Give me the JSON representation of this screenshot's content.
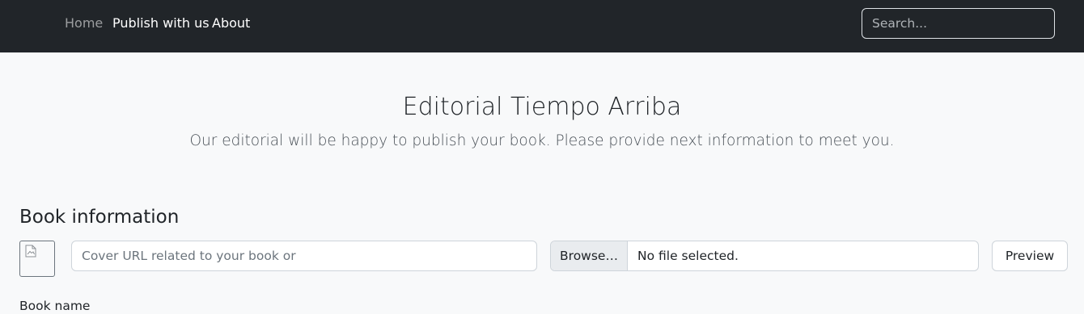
{
  "navbar": {
    "links": [
      {
        "label": "Home",
        "muted": true
      },
      {
        "label": "Publish with us",
        "muted": false
      },
      {
        "label": "About",
        "muted": false
      }
    ],
    "search_placeholder": "Search..."
  },
  "hero": {
    "title": "Editorial Tiempo Arriba",
    "subtitle": "Our editorial will be happy to publish your book. Please provide next information to meet you."
  },
  "book_section": {
    "title": "Book information",
    "cover_placeholder": "Cover URL related to your book or",
    "file_browse_label": "Browse…",
    "file_status": "No file selected.",
    "preview_label": "Preview",
    "book_name_label": "Book name",
    "thumbnail_icon": "broken-image-icon"
  },
  "colors": {
    "navbar_bg": "#212529",
    "page_bg": "#f8f9fa",
    "nav_muted": "rgba(255,255,255,0.55)"
  }
}
